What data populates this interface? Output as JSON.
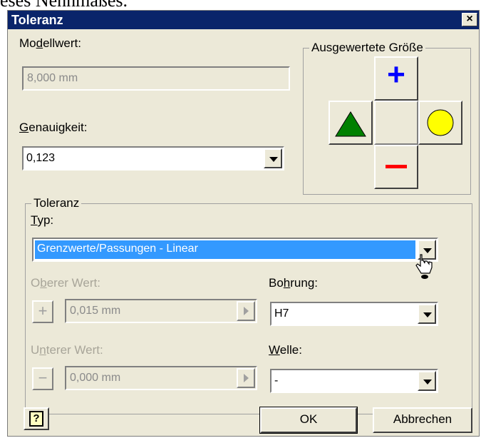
{
  "background_text": "eses Nennmaßes.",
  "dialog": {
    "title": "Toleranz",
    "close_label": "×"
  },
  "modellwert": {
    "label_pre": "Mo",
    "label_u": "d",
    "label_post": "ellwert:",
    "value": "8,000 mm"
  },
  "genauigkeit": {
    "label_u": "G",
    "label_post": "enauigkeit:",
    "value": "0,123"
  },
  "ausgewertete": {
    "label": "Ausgewertete Größe",
    "plus": "+",
    "minus": "−",
    "colors": {
      "plus": "#0000ff",
      "minus": "#ff0000",
      "triangle": "#008000",
      "circle": "#ffff00"
    }
  },
  "toleranz": {
    "group_label": "Toleranz",
    "typ_label_u": "T",
    "typ_label_post": "yp:",
    "typ_value": "Grenzwerte/Passungen - Linear",
    "oberer_label_pre": "O",
    "oberer_label_u": "b",
    "oberer_label_post": "erer Wert:",
    "oberer_value": "0,015 mm",
    "unterer_label_pre": "U",
    "unterer_label_u": "n",
    "unterer_label_post": "terer Wert:",
    "unterer_value": "0,000 mm",
    "bohrung_label_pre": "Bo",
    "bohrung_label_u": "h",
    "bohrung_label_post": "rung:",
    "bohrung_value": "H7",
    "welle_label_u": "W",
    "welle_label_post": "elle:",
    "welle_value": "-",
    "plus_sign": "+",
    "minus_sign": "−"
  },
  "buttons": {
    "help": "?",
    "ok": "OK",
    "cancel": "Abbrechen"
  }
}
